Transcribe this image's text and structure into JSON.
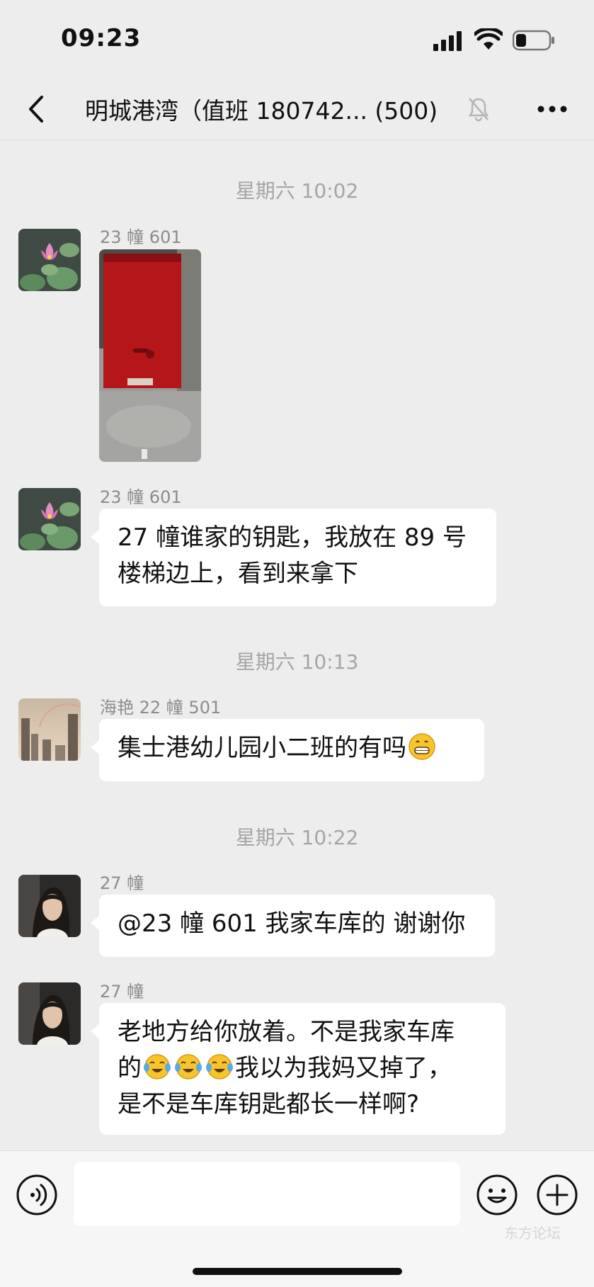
{
  "status_bar": {
    "time": "09:23",
    "icons": [
      "signal-icon",
      "wifi-icon",
      "battery-icon"
    ]
  },
  "nav": {
    "back_icon": "chevron-left-icon",
    "title": "明城港湾（值班 180742...  (500)",
    "mute_icon": "bell-muted-icon",
    "more_icon": "ellipsis-icon"
  },
  "messages": {
    "ts1": "星期六 10:02",
    "m1_sender": "23 幢 601",
    "m2_sender": "23 幢 601",
    "m2_line1": "27 幢谁家的钥匙，我放在 89 号",
    "m2_line2": "楼梯边上，看到来拿下",
    "ts2": "星期六 10:13",
    "m3_sender": "海艳 22 幢 501",
    "m3_text": "集士港幼儿园小二班的有吗",
    "ts3": "星期六 10:22",
    "m4_sender": "27 幢",
    "m4_text": "@23 幢 601  我家车库的  谢谢你",
    "m5_sender": "27 幢",
    "m5_line1": "老地方给你放着。不是我家车库",
    "m5_line2a": "的",
    "m5_line2b": "我以为我妈又掉了，",
    "m5_line3": "是不是车库钥匙都长一样啊?"
  },
  "input_bar": {
    "voice_icon": "voice-icon",
    "emoji_icon": "emoji-icon",
    "plus_icon": "plus-icon",
    "watermark": "东方论坛"
  },
  "colors": {
    "background": "#ededed",
    "bubble": "#ffffff",
    "timestamp": "#a5a5a5",
    "sender": "#8c8c8c"
  }
}
